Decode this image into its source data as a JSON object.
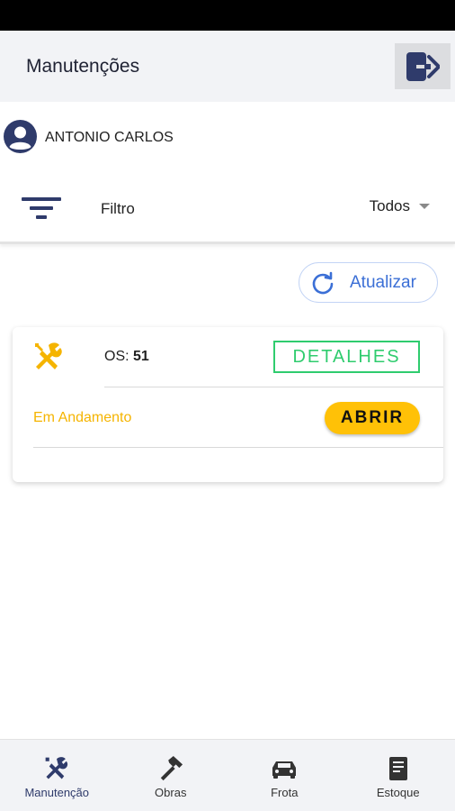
{
  "colors": {
    "primary": "#2f3b6b",
    "accent_blue": "#3b6fd6",
    "success": "#2fcc6e",
    "warning": "#ffc107",
    "status_text": "#f5b400"
  },
  "header": {
    "title": "Manutenções",
    "logout_icon": "logout-icon"
  },
  "user": {
    "name": "ANTONIO CARLOS",
    "avatar_icon": "account-circle-icon"
  },
  "filter": {
    "label": "Filtro",
    "selected": "Todos",
    "icon": "filter-icon"
  },
  "refresh": {
    "label": "Atualizar",
    "icon": "refresh-icon"
  },
  "orders": [
    {
      "icon": "tools-icon",
      "os_prefix": "OS:",
      "os_number": "51",
      "details_label": "DETALHES",
      "status": "Em Andamento",
      "open_label": "ABRIR"
    }
  ],
  "bottom_nav": [
    {
      "label": "Manutenção",
      "icon": "tools-icon",
      "active": true
    },
    {
      "label": "Obras",
      "icon": "hammer-icon",
      "active": false
    },
    {
      "label": "Frota",
      "icon": "car-icon",
      "active": false
    },
    {
      "label": "Estoque",
      "icon": "document-icon",
      "active": false
    }
  ]
}
